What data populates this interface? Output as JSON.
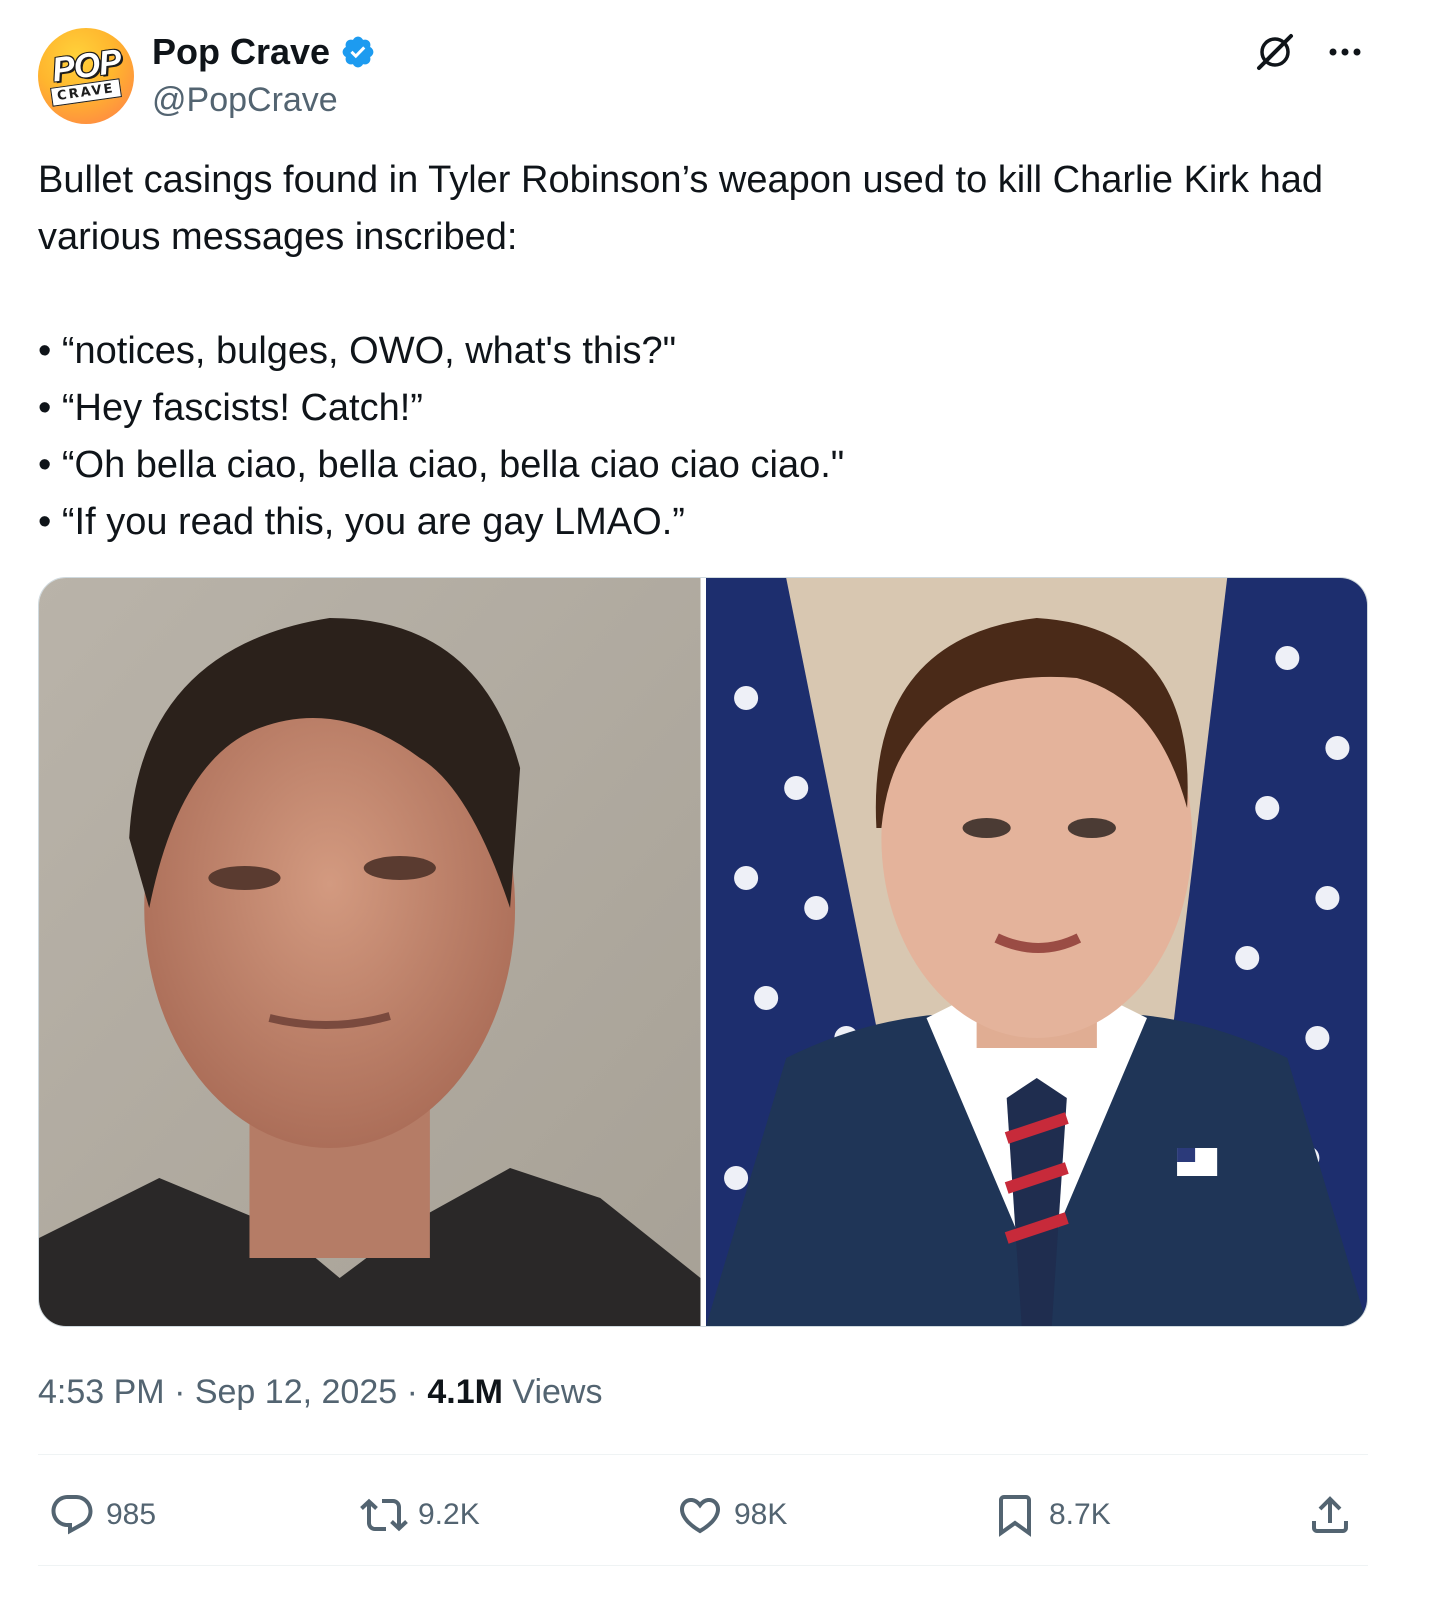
{
  "author": {
    "avatar_text_top": "POP",
    "avatar_text_bottom": "CRAVE",
    "name": "Pop Crave",
    "handle": "@PopCrave",
    "verified": true
  },
  "tweet": {
    "intro": "Bullet casings found in Tyler Robinson’s weapon used to kill Charlie Kirk had various messages inscribed:",
    "bullets": [
      "“notices, bulges, OWO, what's this?\"",
      "“Hey fascists! Catch!”",
      "“Oh bella ciao, bella ciao, bella ciao ciao ciao.\"",
      "“If you read this, you are gay LMAO.”"
    ]
  },
  "meta": {
    "time": "4:53 PM",
    "separator1": " · ",
    "date": "Sep 12, 2025",
    "separator2": " · ",
    "views_count": "4.1M",
    "views_label": " Views"
  },
  "actions": {
    "replies": "985",
    "reposts": "9.2K",
    "likes": "98K",
    "bookmarks": "8.7K"
  },
  "colors": {
    "text": "#0f1419",
    "secondary": "#536471",
    "verified": "#1d9bf0"
  },
  "icons": [
    "grok-icon",
    "more-icon",
    "verified-badge-icon",
    "reply-icon",
    "repost-icon",
    "like-icon",
    "bookmark-icon",
    "share-icon"
  ]
}
